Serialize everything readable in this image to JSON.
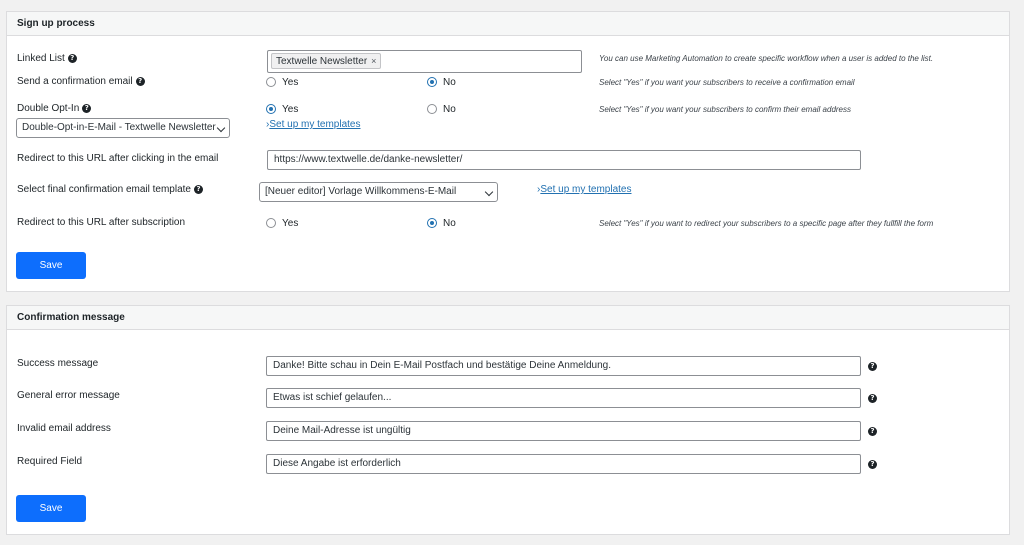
{
  "signup": {
    "title": "Sign up process",
    "linked_list": {
      "label": "Linked List",
      "tag": "Textwelle Newsletter",
      "tag_remove": "×",
      "hint": "You can use Marketing Automation to create specific workflow when a user is added to the list."
    },
    "confirmation_email": {
      "label": "Send a confirmation email",
      "yes": "Yes",
      "no": "No",
      "selected": "no",
      "hint": "Select \"Yes\" if you want your subscribers to receive a confirmation email"
    },
    "double_optin": {
      "label": "Double Opt-In",
      "yes": "Yes",
      "no": "No",
      "selected": "yes",
      "hint": "Select \"Yes\" if you want your subscribers to confirm their email address",
      "template_select": "Double-Opt-in-E-Mail - Textwelle Newsletter",
      "templates_link": "Set up my templates"
    },
    "redirect_click": {
      "label": "Redirect to this URL after clicking in the email",
      "value": "https://www.textwelle.de/danke-newsletter/"
    },
    "final_template": {
      "label": "Select final confirmation email template",
      "select": "[Neuer editor] Vorlage Willkommens-E-Mail",
      "templates_link": "Set up my templates"
    },
    "redirect_subscription": {
      "label": "Redirect to this URL after subscription",
      "yes": "Yes",
      "no": "No",
      "selected": "no",
      "hint": "Select \"Yes\" if you want to redirect your subscribers to a specific page after they fullfill the form"
    },
    "save_label": "Save"
  },
  "confirmation": {
    "title": "Confirmation message",
    "success": {
      "label": "Success message",
      "value": "Danke! Bitte schau in Dein E-Mail Postfach und bestätige Deine Anmeldung."
    },
    "general_error": {
      "label": "General error message",
      "value": "Etwas ist schief gelaufen..."
    },
    "invalid_email": {
      "label": "Invalid email address",
      "value": "Deine Mail-Adresse ist ungültig"
    },
    "required_field": {
      "label": "Required Field",
      "value": "Diese Angabe ist erforderlich"
    },
    "save_label": "Save"
  },
  "help_glyph": "?",
  "link_prefix": "›",
  "colors": {
    "accent": "#0d6efd",
    "link": "#2271b1",
    "panel_bg": "#ffffff",
    "page_bg": "#f1f1f1"
  }
}
